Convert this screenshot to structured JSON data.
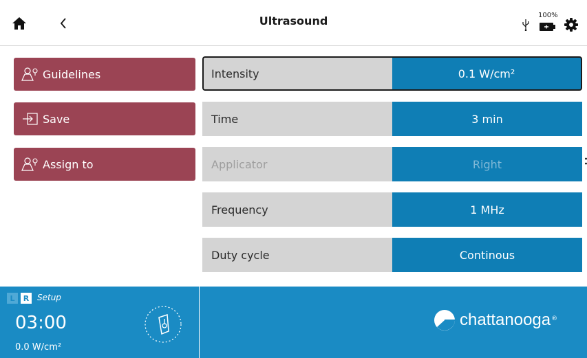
{
  "header": {
    "title": "Ultrasound",
    "battery_percent": "100%"
  },
  "actions": [
    {
      "label": "Guidelines",
      "icon": "guidelines-icon"
    },
    {
      "label": "Save",
      "icon": "save-icon"
    },
    {
      "label": "Assign to",
      "icon": "assign-icon"
    }
  ],
  "params": [
    {
      "label": "Intensity",
      "value": "0.1 W/cm²",
      "state": "selected"
    },
    {
      "label": "Time",
      "value": "3 min",
      "state": "normal"
    },
    {
      "label": "Applicator",
      "value": "Right",
      "state": "disabled"
    },
    {
      "label": "Frequency",
      "value": "1 MHz",
      "state": "normal"
    },
    {
      "label": "Duty cycle",
      "value": "Continous",
      "state": "normal"
    }
  ],
  "footer": {
    "side_left": "L",
    "side_right": "R",
    "mode": "Setup",
    "timer": "03:00",
    "intensity": "0.0 W/cm²",
    "brand": "chattanooga",
    "brand_mark": "®"
  },
  "colors": {
    "header_bg": "#ffffff",
    "action_button": "#9b4454",
    "param_label_bg": "#d4d4d4",
    "param_value_bg": "#0f7eb5",
    "footer_bg": "#1a8bc4"
  }
}
